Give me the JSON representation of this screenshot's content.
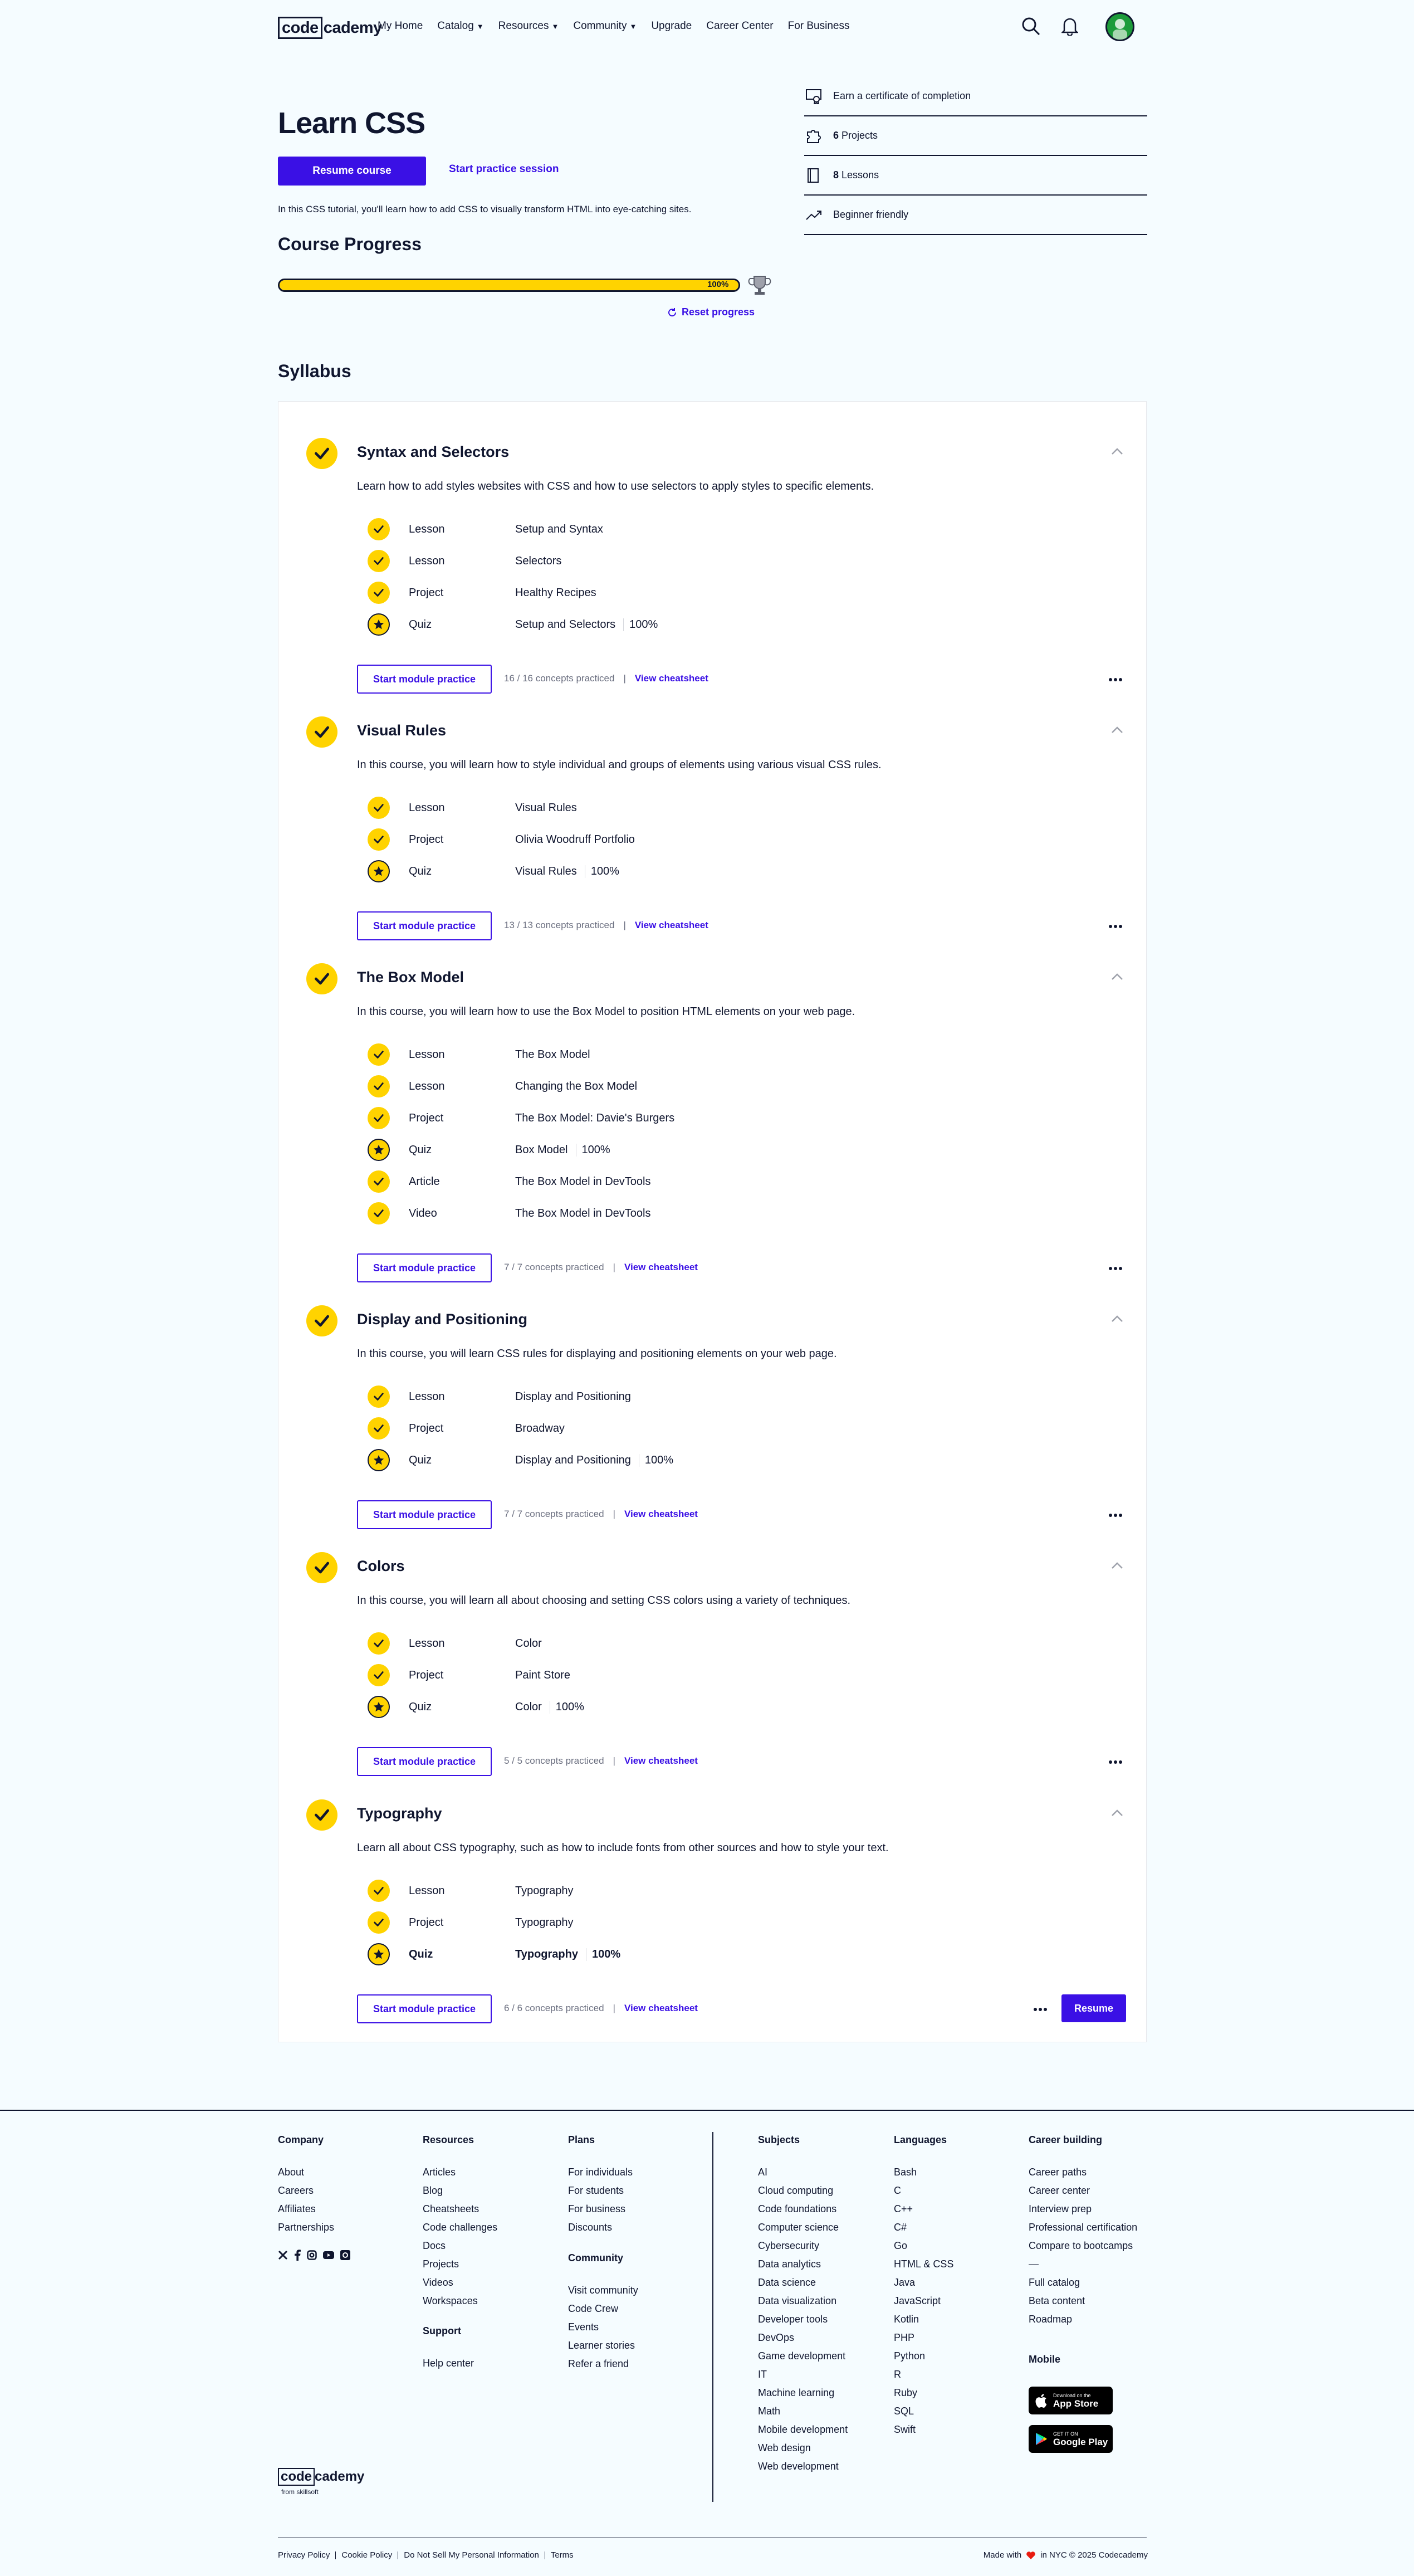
{
  "nav": {
    "logo_code": "code",
    "logo_cademy": "cademy",
    "links": [
      "My Home",
      "Catalog",
      "Resources",
      "Community",
      "Upgrade",
      "Career Center",
      "For Business"
    ]
  },
  "hero": {
    "title": "Learn CSS",
    "resume_label": "Resume course",
    "practice_label": "Start practice session",
    "description": "In this CSS tutorial, you'll learn how to add CSS to visually transform HTML into eye-catching sites.",
    "progress_heading": "Course Progress",
    "progress_value": 1.0,
    "progress_label": "100%",
    "reset_label": "Reset progress"
  },
  "facts": [
    {
      "num": "",
      "text": "Earn a certificate of completion",
      "icon": "certificate-icon"
    },
    {
      "num": "6",
      "text": "Projects",
      "icon": "puzzle-icon"
    },
    {
      "num": "8",
      "text": "Lessons",
      "icon": "book-icon"
    },
    {
      "num": "",
      "text": "Beginner friendly",
      "icon": "trend-up-icon"
    }
  ],
  "syllabus": {
    "heading": "Syllabus",
    "practice_label": "Start module practice",
    "cheatsheet_label": "View cheatsheet",
    "resume_label": "Resume",
    "modules": [
      {
        "title": "Syntax and Selectors",
        "description": "Learn how to add styles websites with CSS and how to use selectors to apply styles to specific elements.",
        "items": [
          {
            "type": "Lesson",
            "name": "Setup and Syntax",
            "score": ""
          },
          {
            "type": "Lesson",
            "name": "Selectors",
            "score": ""
          },
          {
            "type": "Project",
            "name": "Healthy Recipes",
            "score": ""
          },
          {
            "type": "Quiz",
            "name": "Setup and Selectors",
            "score": "100%"
          }
        ],
        "concepts": "16 / 16 concepts practiced"
      },
      {
        "title": "Visual Rules",
        "description": "In this course, you will learn how to style individual and groups of elements using various visual CSS rules.",
        "items": [
          {
            "type": "Lesson",
            "name": "Visual Rules",
            "score": ""
          },
          {
            "type": "Project",
            "name": "Olivia Woodruff Portfolio",
            "score": ""
          },
          {
            "type": "Quiz",
            "name": "Visual Rules",
            "score": "100%"
          }
        ],
        "concepts": "13 / 13 concepts practiced"
      },
      {
        "title": "The Box Model",
        "description": "In this course, you will learn how to use the Box Model to position HTML elements on your web page.",
        "items": [
          {
            "type": "Lesson",
            "name": "The Box Model",
            "score": ""
          },
          {
            "type": "Lesson",
            "name": "Changing the Box Model",
            "score": ""
          },
          {
            "type": "Project",
            "name": "The Box Model: Davie's Burgers",
            "score": ""
          },
          {
            "type": "Quiz",
            "name": "Box Model",
            "score": "100%"
          },
          {
            "type": "Article",
            "name": "The Box Model in DevTools",
            "score": ""
          },
          {
            "type": "Video",
            "name": "The Box Model in DevTools",
            "score": ""
          }
        ],
        "concepts": "7 / 7 concepts practiced"
      },
      {
        "title": "Display and Positioning",
        "description": "In this course, you will learn CSS rules for displaying and positioning elements on your web page.",
        "items": [
          {
            "type": "Lesson",
            "name": "Display and Positioning",
            "score": ""
          },
          {
            "type": "Project",
            "name": "Broadway",
            "score": ""
          },
          {
            "type": "Quiz",
            "name": "Display and Positioning",
            "score": "100%"
          }
        ],
        "concepts": "7 / 7 concepts practiced"
      },
      {
        "title": "Colors",
        "description": "In this course, you will learn all about choosing and setting CSS colors using a variety of techniques.",
        "items": [
          {
            "type": "Lesson",
            "name": "Color",
            "score": ""
          },
          {
            "type": "Project",
            "name": "Paint Store",
            "score": ""
          },
          {
            "type": "Quiz",
            "name": "Color",
            "score": "100%"
          }
        ],
        "concepts": "5 / 5 concepts practiced"
      },
      {
        "title": "Typography",
        "description": "Learn all about CSS typography, such as how to include fonts from other sources and how to style your text.",
        "items": [
          {
            "type": "Lesson",
            "name": "Typography",
            "score": ""
          },
          {
            "type": "Project",
            "name": "Typography",
            "score": ""
          },
          {
            "type": "Quiz",
            "name": "Typography",
            "score": "100%"
          }
        ],
        "concepts": "6 / 6 concepts practiced"
      }
    ]
  },
  "footer": {
    "company": {
      "heading": "Company",
      "items": [
        "About",
        "Careers",
        "Affiliates",
        "Partnerships"
      ]
    },
    "resources": {
      "heading": "Resources",
      "items": [
        "Articles",
        "Blog",
        "Cheatsheets",
        "Code challenges",
        "Docs",
        "Projects",
        "Videos",
        "Workspaces"
      ]
    },
    "support": {
      "heading": "Support",
      "items": [
        "Help center"
      ]
    },
    "plans": {
      "heading": "Plans",
      "items": [
        "For individuals",
        "For students",
        "For business",
        "Discounts"
      ]
    },
    "community": {
      "heading": "Community",
      "items": [
        "Visit community",
        "Code Crew",
        "Events",
        "Learner stories",
        "Refer a friend"
      ]
    },
    "subjects": {
      "heading": "Subjects",
      "items": [
        "AI",
        "Cloud computing",
        "Code foundations",
        "Computer science",
        "Cybersecurity",
        "Data analytics",
        "Data science",
        "Data visualization",
        "Developer tools",
        "DevOps",
        "Game development",
        "IT",
        "Machine learning",
        "Math",
        "Mobile development",
        "Web design",
        "Web development"
      ]
    },
    "languages": {
      "heading": "Languages",
      "items": [
        "Bash",
        "C",
        "C++",
        "C#",
        "Go",
        "HTML & CSS",
        "Java",
        "JavaScript",
        "Kotlin",
        "PHP",
        "Python",
        "R",
        "Ruby",
        "SQL",
        "Swift"
      ]
    },
    "career": {
      "heading": "Career building",
      "items": [
        "Career paths",
        "Career center",
        "Interview prep",
        "Professional certification",
        "Compare to bootcamps",
        "—",
        "Full catalog",
        "Beta content",
        "Roadmap"
      ]
    },
    "mobile": {
      "heading": "Mobile"
    },
    "app_store": {
      "small": "Download on the",
      "big": "App Store"
    },
    "google_play": {
      "small": "GET IT ON",
      "big": "Google Play"
    },
    "logo_code": "code",
    "logo_cademy": "cademy",
    "from": "from skillsoft",
    "legal": [
      "Privacy Policy",
      "Cookie Policy",
      "Do Not Sell My Personal Information",
      "Terms"
    ],
    "made_with": "Made with",
    "made_in": "in NYC © 2025 Codecademy"
  },
  "colors": {
    "accent": "#3a10e5",
    "yellow": "#ffd300",
    "ink": "#10162f",
    "background": "#f5fcff"
  }
}
